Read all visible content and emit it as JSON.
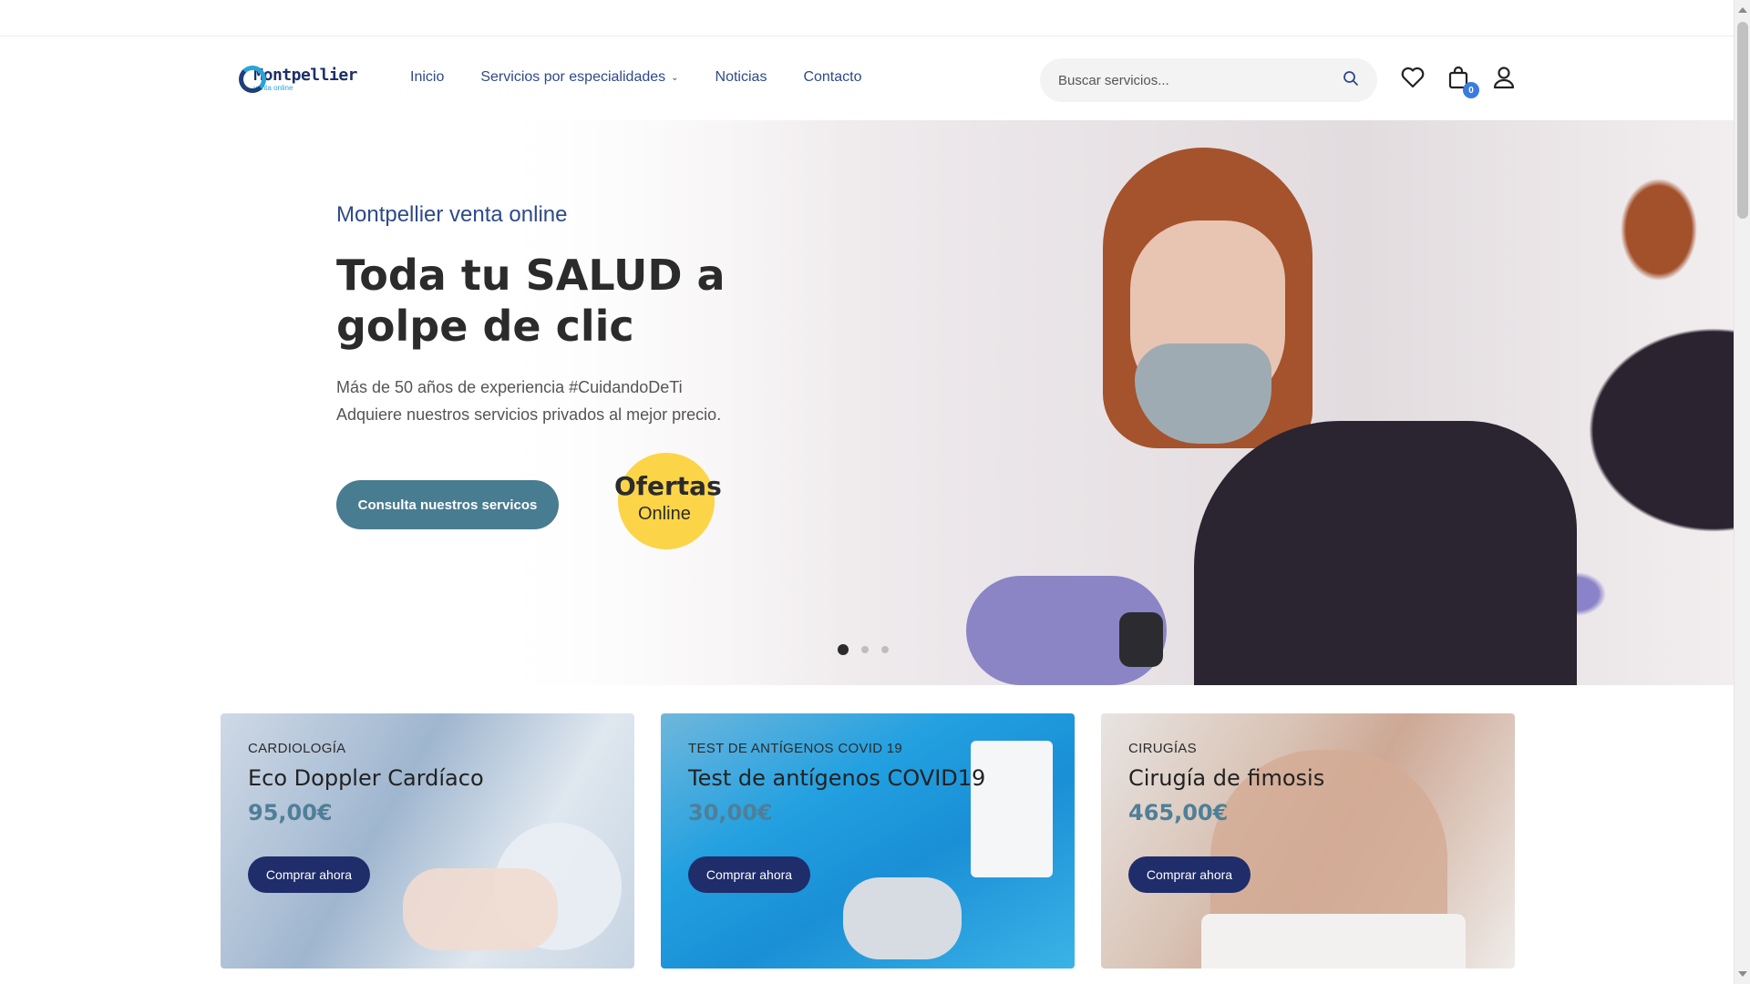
{
  "brand": {
    "name": "Montpellier",
    "tagline": "venta online"
  },
  "nav": {
    "items": [
      {
        "label": "Inicio"
      },
      {
        "label": "Servicios por especialidades",
        "has_dropdown": true
      },
      {
        "label": "Noticias"
      },
      {
        "label": "Contacto"
      }
    ]
  },
  "search": {
    "placeholder": "Buscar servicios..."
  },
  "header_icons": {
    "wishlist": "heart-icon",
    "cart": "bag-icon",
    "account": "user-icon"
  },
  "cart": {
    "count": "0"
  },
  "hero": {
    "kicker": "Montpellier venta online",
    "title": "Toda tu SALUD a golpe de clic",
    "desc_line1": "Más de 50 años de experiencia #CuidandoDeTi",
    "desc_line2": "Adquiere nuestros servicios privados al mejor precio.",
    "cta": "Consulta nuestros servicos",
    "badge_line1": "Ofertas",
    "badge_line2": "Online",
    "slides": 3,
    "active_slide": 1
  },
  "cards": [
    {
      "category": "CARDIOLOGÍA",
      "title": "Eco Doppler Cardíaco",
      "price": "95,00€",
      "button": "Comprar ahora"
    },
    {
      "category": "TEST DE ANTÍGENOS COVID 19",
      "title": "Test de antígenos COVID19",
      "price": "30,00€",
      "button": "Comprar ahora"
    },
    {
      "category": "CIRUGÍAS",
      "title": "Cirugía de fimosis",
      "price": "465,00€",
      "button": "Comprar ahora"
    }
  ],
  "colors": {
    "accent_blue": "#2e4a8a",
    "cta": "#487c90",
    "badge_yellow": "#fcd448",
    "buy_button": "#1f2d6b",
    "price": "#4f7f98"
  }
}
